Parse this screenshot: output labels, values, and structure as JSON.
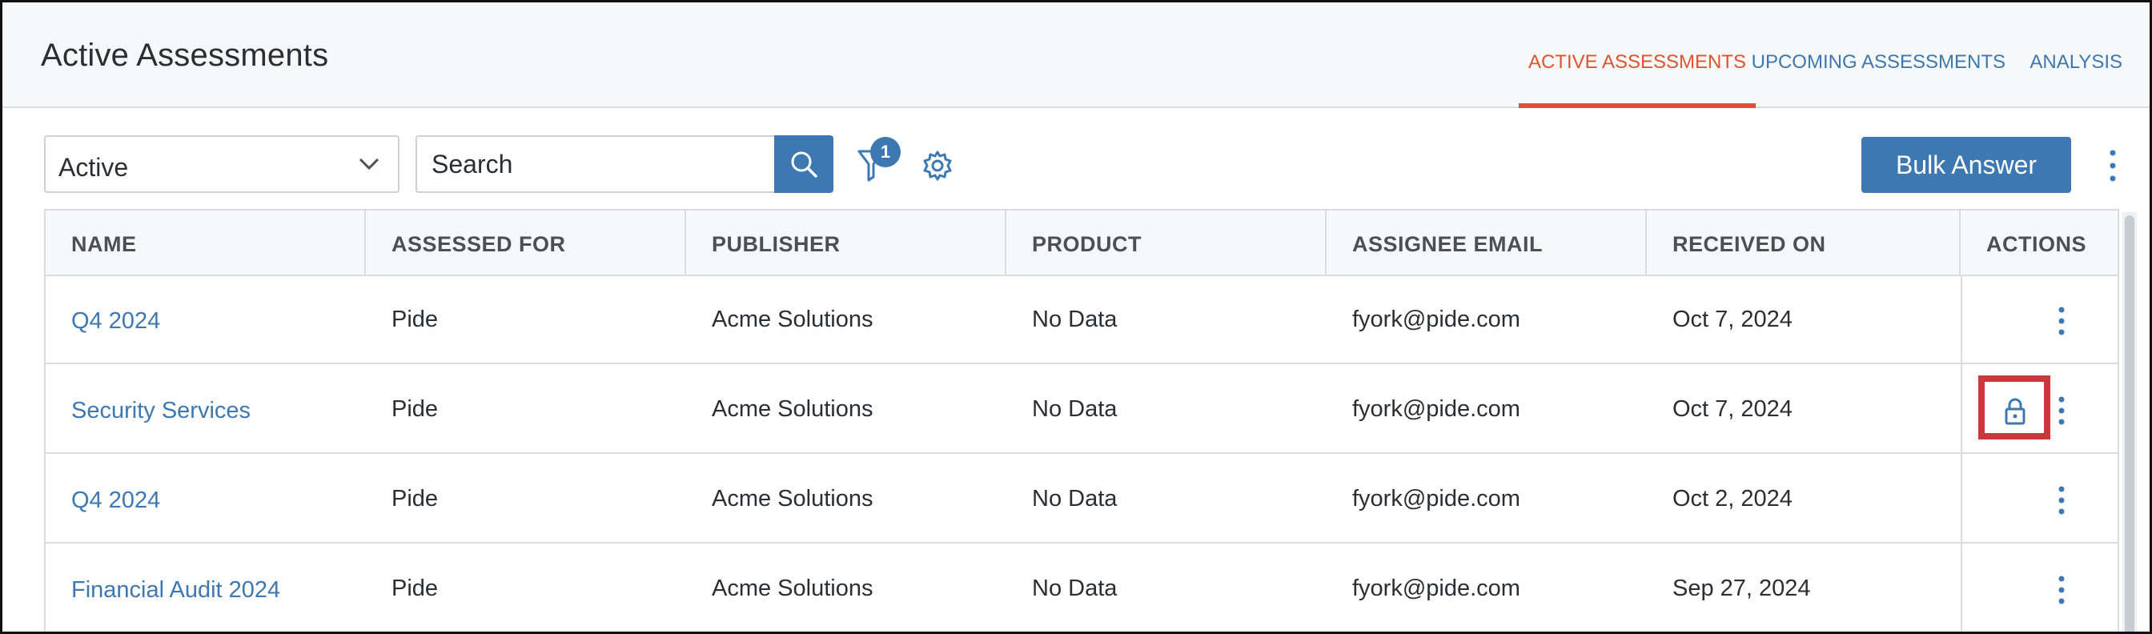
{
  "header": {
    "title": "Active Assessments",
    "tabs": [
      {
        "label": "ACTIVE ASSESSMENTS",
        "active": true
      },
      {
        "label": "UPCOMING ASSESSMENTS",
        "active": false
      },
      {
        "label": "ANALYSIS",
        "active": false
      }
    ]
  },
  "toolbar": {
    "status_value": "Active",
    "search_placeholder": "Search",
    "filter_count": "1",
    "bulk_answer_label": "Bulk Answer"
  },
  "table": {
    "columns": [
      "NAME",
      "ASSESSED FOR",
      "PUBLISHER",
      "PRODUCT",
      "ASSIGNEE EMAIL",
      "RECEIVED ON",
      "ACTIONS"
    ],
    "rows": [
      {
        "name": "Q4 2024",
        "assessed_for": "Pide",
        "publisher": "Acme Solutions",
        "product": "No Data",
        "email": "fyork@pide.com",
        "received": "Oct 7, 2024"
      },
      {
        "name": "Security Services",
        "assessed_for": "Pide",
        "publisher": "Acme Solutions",
        "product": "No Data",
        "email": "fyork@pide.com",
        "received": "Oct 7, 2024"
      },
      {
        "name": "Q4 2024",
        "assessed_for": "Pide",
        "publisher": "Acme Solutions",
        "product": "No Data",
        "email": "fyork@pide.com",
        "received": "Oct 2, 2024"
      },
      {
        "name": "Financial Audit 2024",
        "assessed_for": "Pide",
        "publisher": "Acme Solutions",
        "product": "No Data",
        "email": "fyork@pide.com",
        "received": "Sep 27, 2024"
      }
    ]
  },
  "colors": {
    "accent": "#3e78b2",
    "active_tab": "#e0532f",
    "highlight": "#c8373a"
  },
  "icons": [
    "chevron-down-icon",
    "search-icon",
    "filter-icon",
    "gear-icon",
    "kebab-icon",
    "lock-icon"
  ]
}
